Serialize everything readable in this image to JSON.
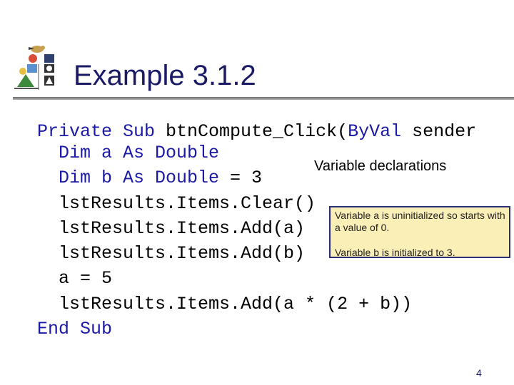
{
  "slide": {
    "title": "Example 3.1.2",
    "page_number": "4"
  },
  "code": [
    {
      "indent": "",
      "parts": [
        {
          "t": "Private Sub ",
          "kw": true
        },
        {
          "t": "btnCompute_Click(",
          "kw": false
        },
        {
          "t": "ByVal",
          "kw": true
        },
        {
          "t": " sender",
          "kw": false
        }
      ]
    },
    {
      "indent": "  ",
      "parts": [
        {
          "t": "Dim a As Double",
          "kw": true
        }
      ]
    },
    {
      "indent": "  ",
      "parts": [
        {
          "t": "Dim b As Double",
          "kw": true
        },
        {
          "t": " = 3",
          "kw": false
        }
      ]
    },
    {
      "indent": "  ",
      "parts": [
        {
          "t": "lstResults.Items.Clear()",
          "kw": false
        }
      ]
    },
    {
      "indent": "  ",
      "parts": [
        {
          "t": "lstResults.Items.Add(a)",
          "kw": false
        }
      ]
    },
    {
      "indent": "  ",
      "parts": [
        {
          "t": "lstResults.Items.Add(b)",
          "kw": false
        }
      ]
    },
    {
      "indent": "  ",
      "parts": [
        {
          "t": "a = 5",
          "kw": false
        }
      ]
    },
    {
      "indent": "  ",
      "parts": [
        {
          "t": "lstResults.Items.Add(a * (2 + b))",
          "kw": false
        }
      ]
    },
    {
      "indent": "",
      "parts": [
        {
          "t": "End Sub",
          "kw": true
        }
      ]
    }
  ],
  "annotations": {
    "declarations_label": "Variable declarations",
    "note_a": "Variable a is uninitialized so starts with a value of 0.",
    "note_b": "Variable b is initialized to 3."
  },
  "colors": {
    "keyword": "#1a1aa6",
    "highlight": "#fbefb8",
    "title": "#1a1a66",
    "note_border": "#2b2f7a"
  },
  "icons": {
    "logo": "shapes-logo-icon"
  }
}
